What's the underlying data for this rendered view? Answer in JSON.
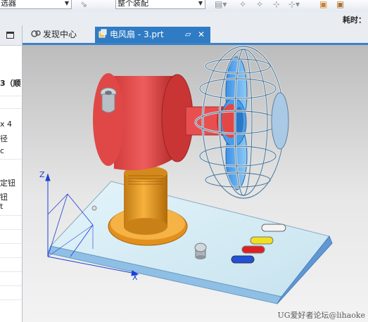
{
  "toolbar": {
    "filter_combo": "选器",
    "assembly_combo": "整个装配",
    "elapsed_label": "耗时："
  },
  "nav_panel": {
    "fragments": [
      "3（顺",
      "x 4",
      "径",
      "c",
      "定钮",
      "钮",
      "t"
    ]
  },
  "tabs": [
    {
      "label": "发现中心",
      "active": false
    },
    {
      "label": "电风扇 - 3.prt",
      "active": true
    }
  ],
  "viewport": {
    "axis_z": "Z",
    "axis_x": "X",
    "watermark": "UG爱好者论坛@lihaoke"
  }
}
